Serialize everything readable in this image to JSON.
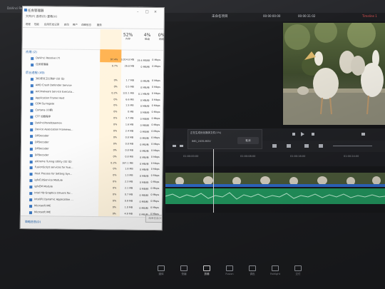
{
  "davinci": {
    "menu": [
      "DaVinci Resolve",
      "文件",
      "编辑",
      "修剪",
      "时间线",
      "片段",
      "标记",
      "显示",
      "Playback",
      "Fusion",
      "调色",
      "Fairlight",
      "工作区",
      "帮助"
    ],
    "title": "未命名项目",
    "timecode_left": "00:00:00:00",
    "timecode_right": "00:00:31:02",
    "red_label": "Timeline 1",
    "dialog_message": "正在生成优化媒体文件(1%)",
    "dialog_filename": "IMG_2035.MOV",
    "dialog_cancel": "取消",
    "ruler_ticks": [
      "01:00:00:00",
      "01:00:08:00",
      "01:00:16:00",
      "01:00:24:00"
    ],
    "nav": [
      {
        "label": "媒体",
        "active": false
      },
      {
        "label": "快编",
        "active": false
      },
      {
        "label": "剪辑",
        "active": true
      },
      {
        "label": "Fusion",
        "active": false
      },
      {
        "label": "调色",
        "active": false
      },
      {
        "label": "Fairlight",
        "active": false
      },
      {
        "label": "交付",
        "active": false
      }
    ]
  },
  "taskmanager": {
    "title": "任务管理器",
    "menu": "文件(F)  选项(O)  查看(V)",
    "tabs": [
      "进程",
      "性能",
      "应用历史记录",
      "启动",
      "用户",
      "详细信息",
      "服务"
    ],
    "columns": [
      {
        "pct": "100%",
        "name": "CPU"
      },
      {
        "pct": "52%",
        "name": "内存"
      },
      {
        "pct": "4%",
        "name": "磁盘"
      },
      {
        "pct": "0%",
        "name": "网络"
      }
    ],
    "group_apps": "应用 (2)",
    "apps": [
      {
        "name": "DaVinci Resolve (7)",
        "cpu": "97.4%",
        "mem": "3,014.8 MB",
        "disk": "19.4 MB/秒",
        "net": "0 Mbps"
      },
      {
        "name": "任务管理器",
        "cpu": "0.7%",
        "mem": "26.8 MB",
        "disk": "0 MB/秒",
        "net": "0 Mbps"
      }
    ],
    "group_bg": "后台进程 (49)",
    "bg": [
      {
        "name": "360安全卫士防护 (32 位)",
        "cpu": "0%",
        "mem": "1.7 MB",
        "disk": "0 MB/秒",
        "net": "0 Mbps"
      },
      {
        "name": "AMD Crash Defender Service",
        "cpu": "0%",
        "mem": "0.5 MB",
        "disk": "0 MB/秒",
        "net": "0 Mbps"
      },
      {
        "name": "Antimalware Service Executa...",
        "cpu": "0.2%",
        "mem": "122.1 MB",
        "disk": "0.1 MB/秒",
        "net": "0 Mbps"
      },
      {
        "name": "Application Frame Host",
        "cpu": "0%",
        "mem": "6.6 MB",
        "disk": "0 MB/秒",
        "net": "0 Mbps"
      },
      {
        "name": "COM Surrogate",
        "cpu": "0%",
        "mem": "1.5 MB",
        "disk": "0 MB/秒",
        "net": "0 Mbps"
      },
      {
        "name": "Cortana (小娜)",
        "cpu": "0%",
        "mem": "0 MB",
        "disk": "0 MB/秒",
        "net": "0 Mbps"
      },
      {
        "name": "CTF 加载程序",
        "cpu": "0%",
        "mem": "3.7 MB",
        "disk": "0 MB/秒",
        "net": "0 Mbps"
      },
      {
        "name": "DaVinciPanelDaemon",
        "cpu": "0%",
        "mem": "1.6 MB",
        "disk": "0 MB/秒",
        "net": "0 Mbps"
      },
      {
        "name": "Device Association Framewo...",
        "cpu": "0%",
        "mem": "2.4 MB",
        "disk": "0 MB/秒",
        "net": "0 Mbps"
      },
      {
        "name": "DPDecoder",
        "cpu": "0%",
        "mem": "0.8 MB",
        "disk": "0 MB/秒",
        "net": "0 Mbps"
      },
      {
        "name": "DPDecoder",
        "cpu": "0%",
        "mem": "0.8 MB",
        "disk": "0 MB/秒",
        "net": "0 Mbps"
      },
      {
        "name": "DPDecoder",
        "cpu": "0%",
        "mem": "0.8 MB",
        "disk": "0 MB/秒",
        "net": "0 Mbps"
      },
      {
        "name": "DPDecoder",
        "cpu": "0%",
        "mem": "0.8 MB",
        "disk": "0 MB/秒",
        "net": "0 Mbps"
      },
      {
        "name": "eXtreme Tuning Utility (32 位)",
        "cpu": "0.2%",
        "mem": "167.1 MB",
        "disk": "0 MB/秒",
        "net": "0 Mbps"
      },
      {
        "name": "FusionScript services for Fusi...",
        "cpu": "0%",
        "mem": "1.8 MB",
        "disk": "0 MB/秒",
        "net": "0 Mbps"
      },
      {
        "name": "Host Process for Setting Syn...",
        "cpu": "0%",
        "mem": "1.3 MB",
        "disk": "0 MB/秒",
        "net": "0 Mbps"
      },
      {
        "name": "igfxCUIService Module",
        "cpu": "0%",
        "mem": "2.3 MB",
        "disk": "0 MB/秒",
        "net": "0 Mbps"
      },
      {
        "name": "igfxEM Module",
        "cpu": "0%",
        "mem": "2.1 MB",
        "disk": "0 MB/秒",
        "net": "0 Mbps"
      },
      {
        "name": "Intel HD Graphics Drivers for...",
        "cpu": "0%",
        "mem": "0.7 MB",
        "disk": "0 MB/秒",
        "net": "0 Mbps"
      },
      {
        "name": "Intel(R) Dynamic Application ...",
        "cpu": "0%",
        "mem": "0.9 MB",
        "disk": "0 MB/秒",
        "net": "0 Mbps"
      },
      {
        "name": "Microsoft IME",
        "cpu": "0%",
        "mem": "1.0 MB",
        "disk": "0 MB/秒",
        "net": "0 Mbps"
      },
      {
        "name": "Microsoft IME",
        "cpu": "0%",
        "mem": "4.9 MB",
        "disk": "0 MB/秒",
        "net": "0 Mbps"
      },
      {
        "name": "Microsoft Network Realtime ...",
        "cpu": "0%",
        "mem": "2.0 MB",
        "disk": "0 MB/秒",
        "net": "0 Mbps"
      },
      {
        "name": "Microsoft Store (2)",
        "cpu": "0%",
        "mem": "0 MB",
        "disk": "0 MB/秒",
        "net": "0 Mbps"
      }
    ],
    "fewer_details": "简略信息(D)",
    "end_task": "结束任务(E)"
  }
}
